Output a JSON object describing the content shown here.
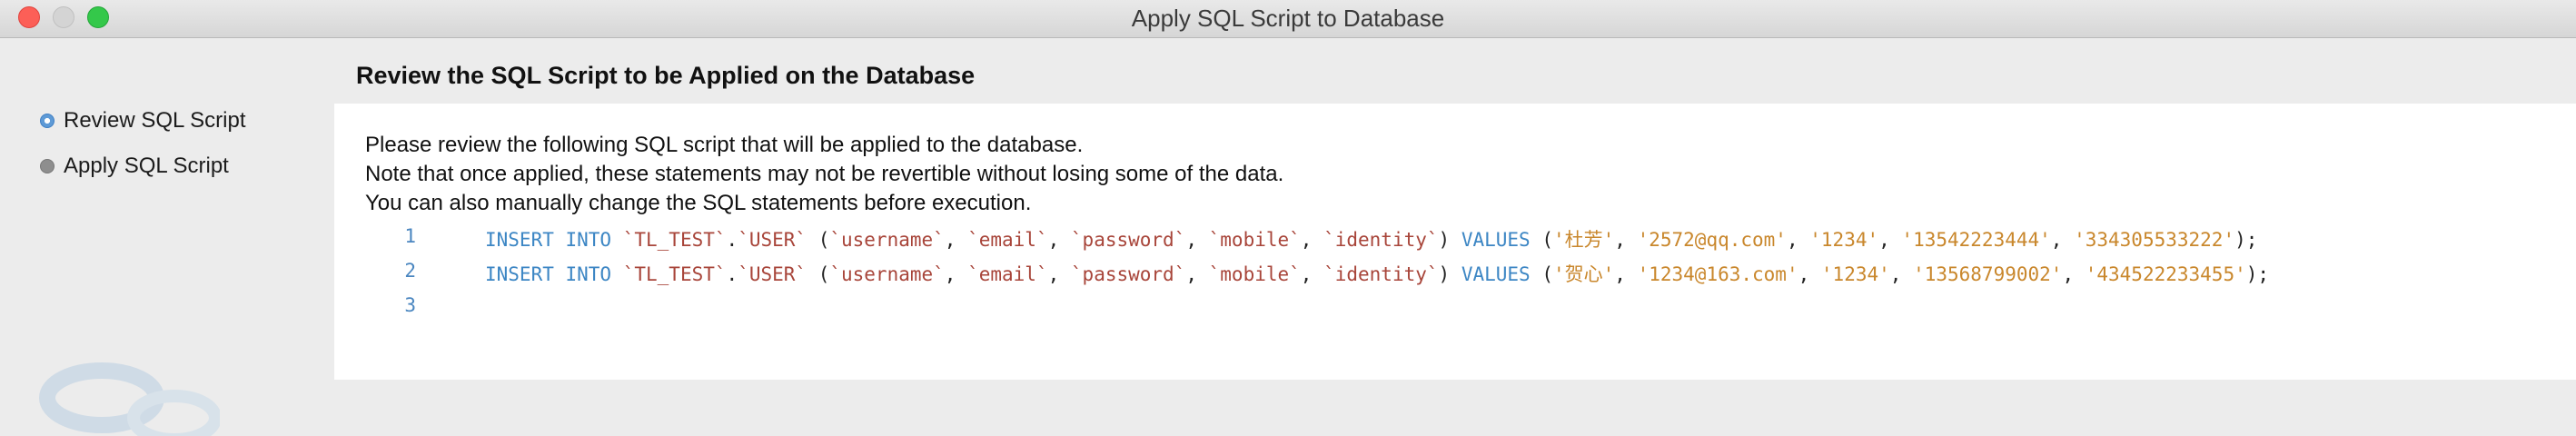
{
  "window": {
    "title": "Apply SQL Script to Database"
  },
  "sidebar": {
    "steps": [
      {
        "label": "Review SQL Script",
        "active": true
      },
      {
        "label": "Apply SQL Script",
        "active": false
      }
    ]
  },
  "main": {
    "header": "Review the SQL Script to be Applied on the Database",
    "description": [
      "Please review the following SQL script that will be applied to the database.",
      "Note that once applied, these statements may not be revertible without losing some of the data.",
      "You can also manually change the SQL statements before execution."
    ],
    "script": {
      "line_numbers": [
        "1",
        "2",
        "3"
      ],
      "lines": [
        {
          "insert": "INSERT INTO",
          "schema": "`TL_TEST`",
          "table": "`USER`",
          "columns": [
            "`username`",
            "`email`",
            "`password`",
            "`mobile`",
            "`identity`"
          ],
          "values_kw": "VALUES",
          "values": [
            "'杜芳'",
            "'2572@qq.com'",
            "'1234'",
            "'13542223444'",
            "'334305533222'"
          ]
        },
        {
          "insert": "INSERT INTO",
          "schema": "`TL_TEST`",
          "table": "`USER`",
          "columns": [
            "`username`",
            "`email`",
            "`password`",
            "`mobile`",
            "`identity`"
          ],
          "values_kw": "VALUES",
          "values": [
            "'贺心'",
            "'1234@163.com'",
            "'1234'",
            "'13568799002'",
            "'434522233455'"
          ]
        },
        null
      ]
    }
  },
  "colors": {
    "keyword": "#3c86c4",
    "identifier": "#a8453a",
    "string": "#c9872c",
    "line_number": "#4a86c0"
  }
}
